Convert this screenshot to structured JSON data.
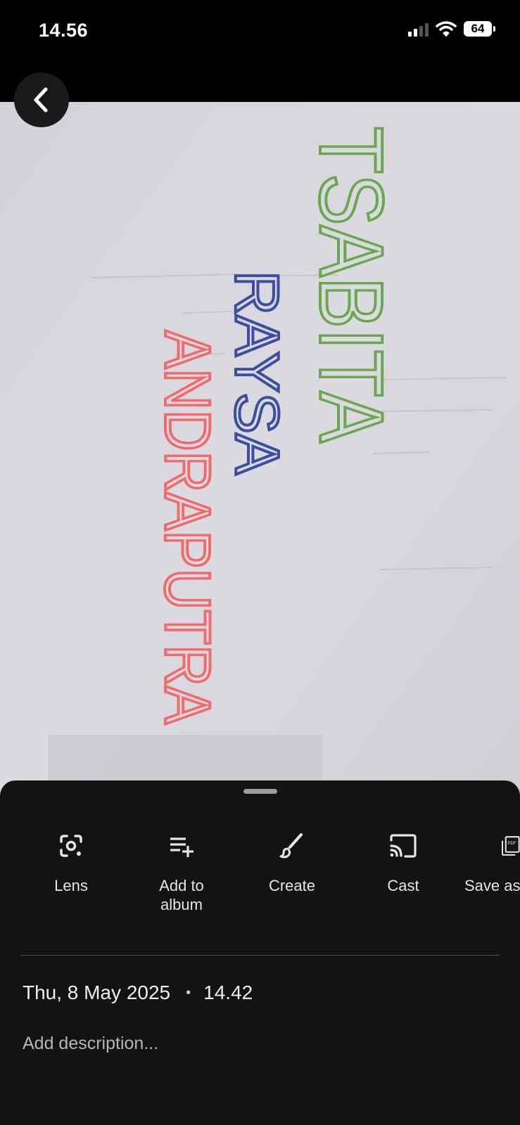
{
  "status_bar": {
    "time": "14.56",
    "battery": "64",
    "icons": [
      "signal-icon",
      "wifi-icon",
      "battery-icon"
    ]
  },
  "photo": {
    "handwriting_lines": [
      {
        "text": "TSABITA",
        "color": "#6aa84f"
      },
      {
        "text": "RAYSA",
        "color": "#3c4ea0"
      },
      {
        "text": "ANDRAPUTRA",
        "color": "#f06b6b"
      }
    ]
  },
  "back_button": {
    "icon": "chevron-left-icon"
  },
  "actions": [
    {
      "label": "Lens",
      "icon": "lens-icon"
    },
    {
      "label": "Add to\nalbum",
      "icon": "add-to-playlist-icon"
    },
    {
      "label": "Create",
      "icon": "brush-icon"
    },
    {
      "label": "Cast",
      "icon": "cast-icon"
    },
    {
      "label": "Save as",
      "icon": "pdf-icon"
    }
  ],
  "info": {
    "date": "Thu, 8 May 2025",
    "separator": "•",
    "time": "14.42",
    "description_placeholder": "Add description..."
  }
}
